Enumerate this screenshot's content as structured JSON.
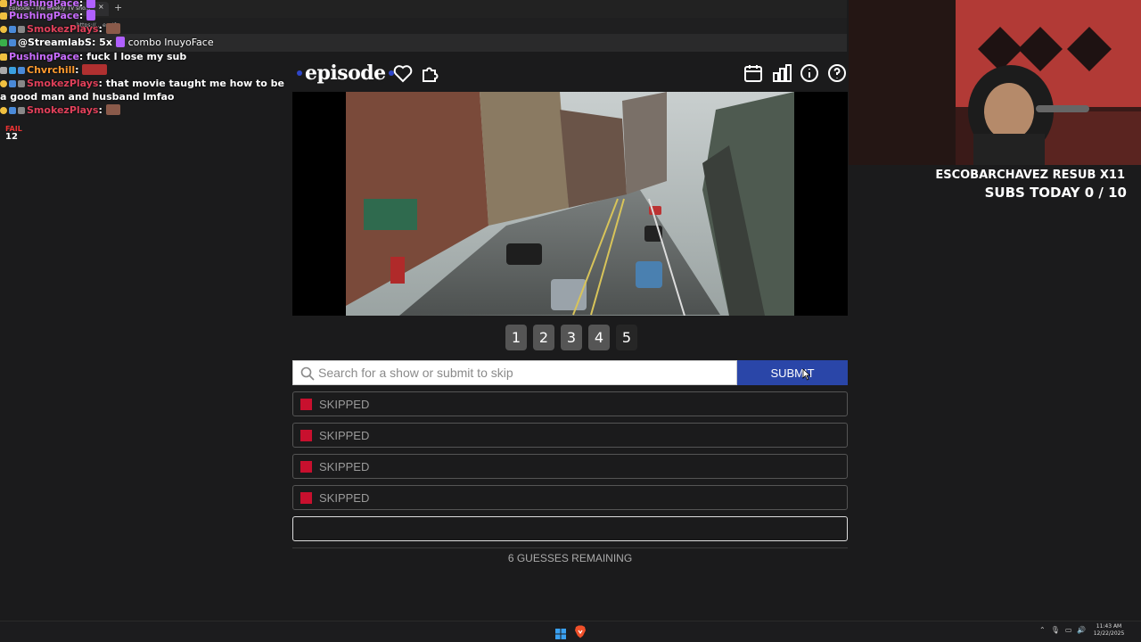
{
  "browser": {
    "tab_title": "Episode - The weekly TV sho...",
    "url_text": "https://... e.wtf"
  },
  "chat": {
    "messages": [
      {
        "user": "PushingPace",
        "color": "#c86cff",
        "text": ""
      },
      {
        "user": "PushingPace",
        "color": "#c86cff",
        "text": ""
      },
      {
        "user": "SmokezPlays",
        "color": "#e0405a",
        "text": ""
      },
      {
        "user": "@StreamlabS: 5x",
        "color": "#ffffff",
        "text": "combo InuyoFace"
      },
      {
        "user": "PushingPace",
        "color": "#c86cff",
        "text": "fuck I lose my sub"
      },
      {
        "user": "Chvrchill",
        "color": "#ff9a2e",
        "text": ""
      },
      {
        "user": "SmokezPlays",
        "color": "#e0405a",
        "text": "that movie taught me how to be a good man and husband lmfao"
      },
      {
        "user": "SmokezPlays",
        "color": "#e0405a",
        "text": ""
      }
    ],
    "fail_label": "FAIL",
    "fail_count": "12"
  },
  "game": {
    "logo": "episode",
    "clues": [
      "1",
      "2",
      "3",
      "4",
      "5"
    ],
    "search": {
      "placeholder": "Search for a show or submit to skip",
      "value": ""
    },
    "submit_label": "SUBMIT",
    "guesses": [
      "SKIPPED",
      "SKIPPED",
      "SKIPPED",
      "SKIPPED",
      ""
    ],
    "remaining": "6 GUESSES REMAINING",
    "accent_color": "#2a46a8",
    "skip_color": "#c8102e"
  },
  "stream": {
    "resub": "ESCOBARCHAVEZ RESUB X11",
    "subs_today": "SUBS TODAY 0 / 10"
  },
  "taskbar": {
    "time": "11:43 AM",
    "date": "12/22/2025"
  }
}
